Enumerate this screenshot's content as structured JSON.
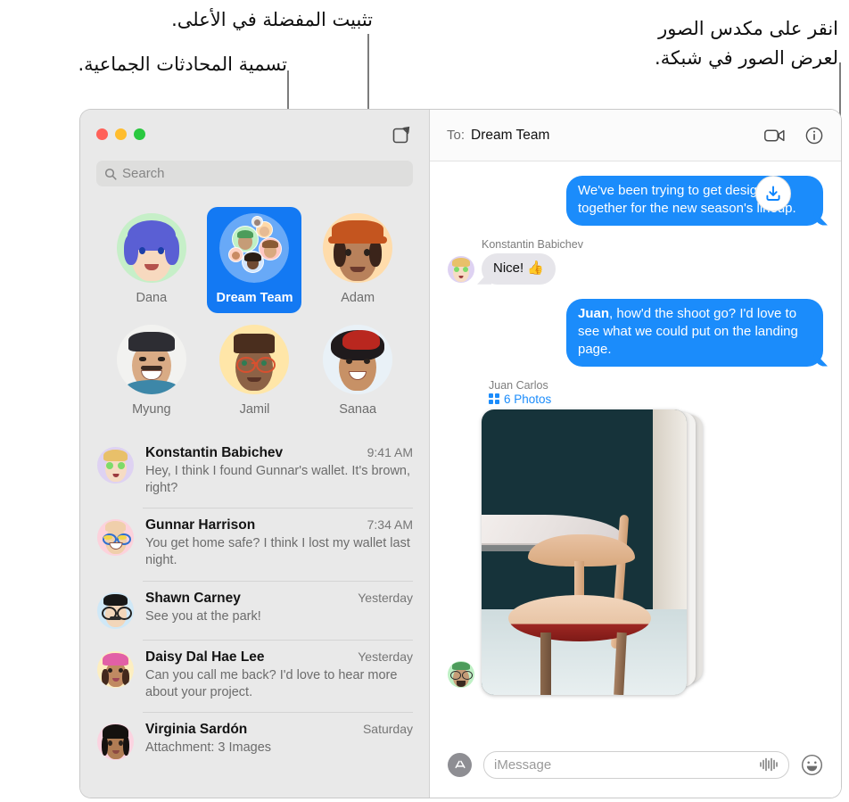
{
  "annotations": {
    "pin_favorites": "تثبيت المفضلة في الأعلى.",
    "name_group_conversations": "تسمية المحادثات الجماعية.",
    "tap_photo_stack": "انقر على مكدس الصور\nلعرض الصور في شبكة."
  },
  "window": {
    "traffic_lights": {
      "close": "close",
      "minimize": "minimize",
      "maximize": "maximize"
    }
  },
  "sidebar": {
    "compose_icon": "compose-icon",
    "search": {
      "placeholder": "Search",
      "icon": "search-icon"
    },
    "pinned": [
      {
        "label": "Dana",
        "selected": false,
        "type": "person"
      },
      {
        "label": "Dream Team",
        "selected": true,
        "type": "group"
      },
      {
        "label": "Adam",
        "selected": false,
        "type": "person"
      },
      {
        "label": "Myung",
        "selected": false,
        "type": "person"
      },
      {
        "label": "Jamil",
        "selected": false,
        "type": "person"
      },
      {
        "label": "Sanaa",
        "selected": false,
        "type": "person"
      }
    ],
    "conversations": [
      {
        "name": "Konstantin Babichev",
        "time": "9:41 AM",
        "preview": "Hey, I think I found Gunnar's wallet. It's brown, right?"
      },
      {
        "name": "Gunnar Harrison",
        "time": "7:34 AM",
        "preview": "You get home safe? I think I lost my wallet last night."
      },
      {
        "name": "Shawn Carney",
        "time": "Yesterday",
        "preview": "See you at the park!"
      },
      {
        "name": "Daisy Dal Hae Lee",
        "time": "Yesterday",
        "preview": "Can you call me back? I'd love to hear more about your project."
      },
      {
        "name": "Virginia Sardón",
        "time": "Saturday",
        "preview": "Attachment: 3 Images"
      }
    ]
  },
  "conversation": {
    "to_label": "To:",
    "to_value": "Dream Team",
    "facetime_icon": "video-camera-icon",
    "info_icon": "info-circle-icon",
    "messages": [
      {
        "direction": "out",
        "text": "We've been trying to get designs together for the new season's lineup."
      },
      {
        "direction": "in",
        "sender": "Konstantin Babichev",
        "text": "Nice!  👍"
      },
      {
        "direction": "out",
        "bold_prefix": "Juan",
        "text": ", how'd the shoot go? I'd love to see what we could put on the landing page."
      }
    ],
    "attachment": {
      "sender": "Juan Carlos",
      "count_label": "6 Photos",
      "grid_icon": "grid-icon",
      "download_icon": "download-icon"
    }
  },
  "compose": {
    "apps_icon": "app-store-icon",
    "placeholder": "iMessage",
    "audio_icon": "audio-waveform-icon",
    "emoji_icon": "emoji-smiley-icon"
  },
  "colors": {
    "accent_blue": "#1b8cfb",
    "selected_tile": "#1379f3",
    "sidebar_bg": "#e9e9e9",
    "incoming_bubble": "#e6e5ea"
  }
}
